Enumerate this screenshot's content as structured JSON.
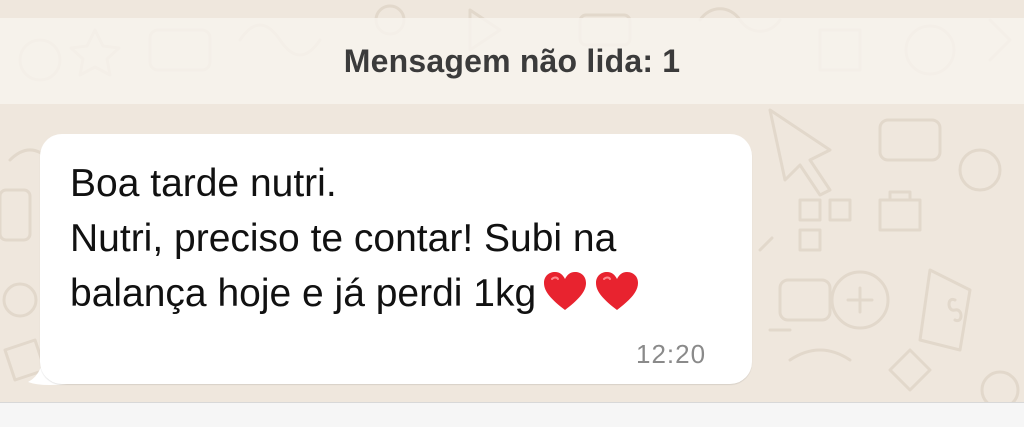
{
  "chat": {
    "unread_banner": "Mensagem não lida: 1",
    "message": {
      "lines": [
        "Boa tarde nutri.",
        "Nutri, preciso te contar! Subi na",
        "balança hoje e já perdi 1kg"
      ],
      "emojis": [
        "red-heart",
        "red-heart"
      ],
      "time": "12:20"
    }
  },
  "colors": {
    "wallpaper": "#efe7dd",
    "bubble": "#ffffff",
    "heart": "#e8232f"
  }
}
